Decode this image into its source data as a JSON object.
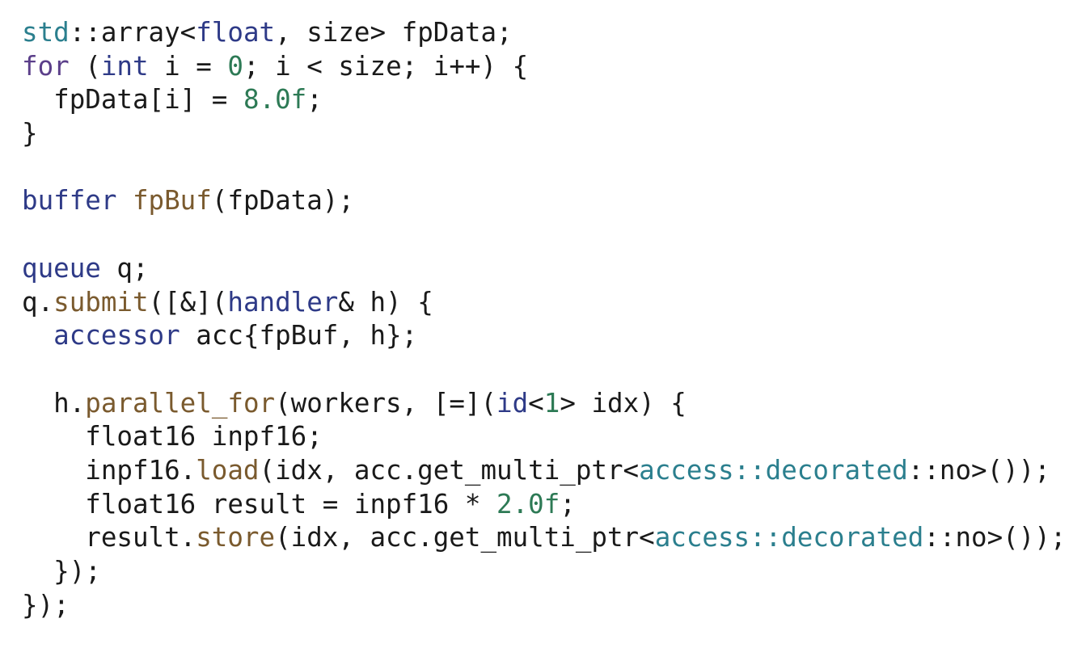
{
  "code": {
    "lines": [
      [
        [
          "std",
          "namespace"
        ],
        [
          "::array<",
          "plain"
        ],
        [
          "float",
          "type"
        ],
        [
          ", size> fpData;",
          "plain"
        ]
      ],
      [
        [
          "for",
          "keyword"
        ],
        [
          " (",
          "plain"
        ],
        [
          "int",
          "type"
        ],
        [
          " i = ",
          "plain"
        ],
        [
          "0",
          "number"
        ],
        [
          "; i < size; i++) {",
          "plain"
        ]
      ],
      [
        [
          "  fpData[i] = ",
          "plain"
        ],
        [
          "8.0f",
          "number"
        ],
        [
          ";",
          "plain"
        ]
      ],
      [
        [
          "}",
          "plain"
        ]
      ],
      [],
      [
        [
          "buffer",
          "type"
        ],
        [
          " ",
          "plain"
        ],
        [
          "fpBuf",
          "func"
        ],
        [
          "(fpData);",
          "plain"
        ]
      ],
      [],
      [
        [
          "queue",
          "type"
        ],
        [
          " q;",
          "plain"
        ]
      ],
      [
        [
          "q.",
          "plain"
        ],
        [
          "submit",
          "func"
        ],
        [
          "([&](",
          "plain"
        ],
        [
          "handler",
          "type"
        ],
        [
          "& h) {",
          "plain"
        ]
      ],
      [
        [
          "  ",
          "plain"
        ],
        [
          "accessor",
          "type"
        ],
        [
          " acc{fpBuf, h};",
          "plain"
        ]
      ],
      [],
      [
        [
          "  h.",
          "plain"
        ],
        [
          "parallel_for",
          "func"
        ],
        [
          "(workers, [=](",
          "plain"
        ],
        [
          "id",
          "type"
        ],
        [
          "<",
          "plain"
        ],
        [
          "1",
          "number"
        ],
        [
          "> idx) {",
          "plain"
        ]
      ],
      [
        [
          "    float16 inpf16;",
          "plain"
        ]
      ],
      [
        [
          "    inpf16.",
          "plain"
        ],
        [
          "load",
          "func"
        ],
        [
          "(idx, acc.get_multi_ptr<",
          "plain"
        ],
        [
          "access::decorated",
          "namespace"
        ],
        [
          "::no>());",
          "plain"
        ]
      ],
      [
        [
          "    float16 result = inpf16 * ",
          "plain"
        ],
        [
          "2.0f",
          "number"
        ],
        [
          ";",
          "plain"
        ]
      ],
      [
        [
          "    result.",
          "plain"
        ],
        [
          "store",
          "func"
        ],
        [
          "(idx, acc.get_multi_ptr<",
          "plain"
        ],
        [
          "access::decorated",
          "namespace"
        ],
        [
          "::no>());",
          "plain"
        ]
      ],
      [
        [
          "  });",
          "plain"
        ]
      ],
      [
        [
          "});",
          "plain"
        ]
      ]
    ]
  }
}
